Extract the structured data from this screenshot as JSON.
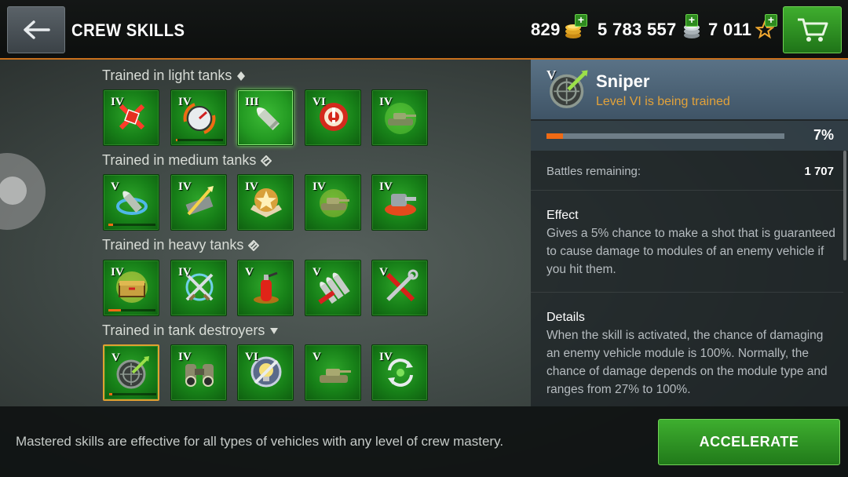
{
  "header": {
    "title": "CREW SKILLS",
    "currencies": {
      "gold": "829",
      "credits": "5 783 557",
      "free_xp": "7 011"
    },
    "plus": "+"
  },
  "sections": [
    {
      "title": "Trained in light tanks",
      "skills": [
        {
          "level": "IV",
          "icon": "crit-hit-icon"
        },
        {
          "level": "IV",
          "icon": "repair-gauge-icon",
          "progress": 0.03
        },
        {
          "level": "III",
          "icon": "shell-icon"
        },
        {
          "level": "VI",
          "icon": "alert-target-icon"
        },
        {
          "level": "IV",
          "icon": "tank-glow-icon"
        }
      ]
    },
    {
      "title": "Trained in medium tanks",
      "skills": [
        {
          "level": "V",
          "icon": "shell-swirl-icon",
          "progress": 0.1
        },
        {
          "level": "IV",
          "icon": "armor-pierce-icon"
        },
        {
          "level": "IV",
          "icon": "star-badge-icon"
        },
        {
          "level": "IV",
          "icon": "tank-spark-icon"
        },
        {
          "level": "IV",
          "icon": "turret-fire-icon"
        }
      ]
    },
    {
      "title": "Trained in heavy tanks",
      "skills": [
        {
          "level": "IV",
          "icon": "ammo-crate-icon",
          "progress": 0.26
        },
        {
          "level": "IV",
          "icon": "crossed-swords-icon"
        },
        {
          "level": "V",
          "icon": "extinguisher-icon"
        },
        {
          "level": "V",
          "icon": "ammo-rack-icon"
        },
        {
          "level": "V",
          "icon": "tools-icon"
        }
      ]
    },
    {
      "title": "Trained in tank destroyers",
      "skills": [
        {
          "level": "V",
          "icon": "sniper-icon",
          "progress": 0.07
        },
        {
          "level": "IV",
          "icon": "binoculars-icon"
        },
        {
          "level": "VI",
          "icon": "camo-bulb-icon"
        },
        {
          "level": "V",
          "icon": "tank-aim-icon"
        },
        {
          "level": "IV",
          "icon": "reload-cycle-icon"
        }
      ]
    }
  ],
  "detail": {
    "level": "V",
    "name": "Sniper",
    "status": "Level VI is being trained",
    "progress_label": "7%",
    "progress": 0.07,
    "battles_label": "Battles remaining:",
    "battles_value": "1 707",
    "effect_label": "Effect",
    "effect_text": "Gives a 5% chance to make a shot that is guaranteed to cause damage to modules of an enemy vehicle if you hit them.",
    "details_label": "Details",
    "details_text": "When the skill is activated, the chance of damaging an enemy vehicle module is 100%. Normally, the chance of damage depends on the module type and ranges from 27% to 100%."
  },
  "footer": {
    "note": "Mastered skills are effective for all types of vehicles with any level of crew mastery.",
    "accelerate_label": "ACCELERATE"
  },
  "colors": {
    "accent_orange": "#f06a14",
    "status_orange": "#e2a23a",
    "tile_green": "#178018",
    "button_green": "#2e8a1f"
  }
}
